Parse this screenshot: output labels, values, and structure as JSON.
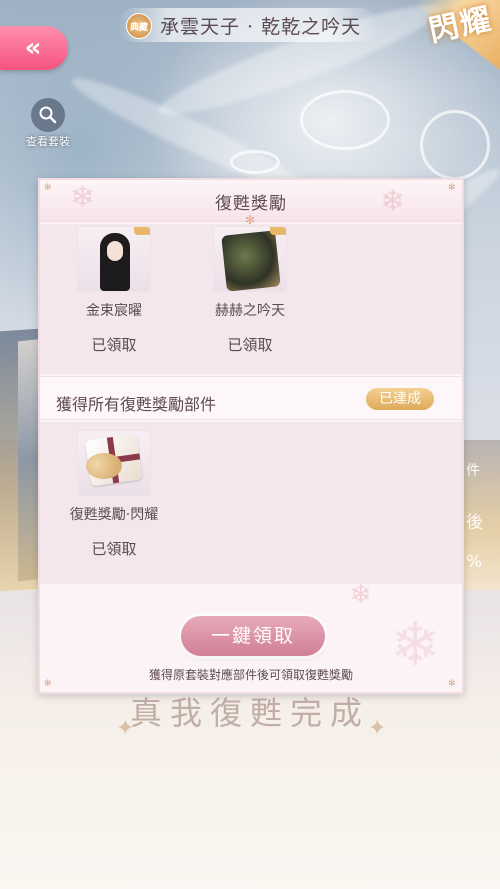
{
  "header": {
    "back_glyph": "«",
    "badge": "典藏",
    "title": "承雲天子 · 乾乾之吟天",
    "corner_badge": "閃耀"
  },
  "view_set": {
    "label": "查看套裝",
    "icon": "search-icon"
  },
  "side_texts": [
    "件",
    "後",
    "%"
  ],
  "dialog": {
    "title": "復甦獎勵",
    "rewards": [
      {
        "name": "金束宸曜",
        "status": "已領取"
      },
      {
        "name": "赫赫之吟天",
        "status": "已領取"
      }
    ],
    "section": {
      "title": "獲得所有復甦獎勵部件",
      "badge": "已達成"
    },
    "section_rewards": [
      {
        "name": "復甦獎勵·閃耀",
        "status": "已領取"
      }
    ],
    "claim_button": "一鍵領取",
    "hint": "獲得原套裝對應部件後可領取復甦獎勵"
  },
  "background_text": "真我復甦完成",
  "colors": {
    "back_button": "#f4537f",
    "claim_button": "#d17f96",
    "achieved_badge": "#dcaa5a",
    "text": "#5e4a53"
  }
}
